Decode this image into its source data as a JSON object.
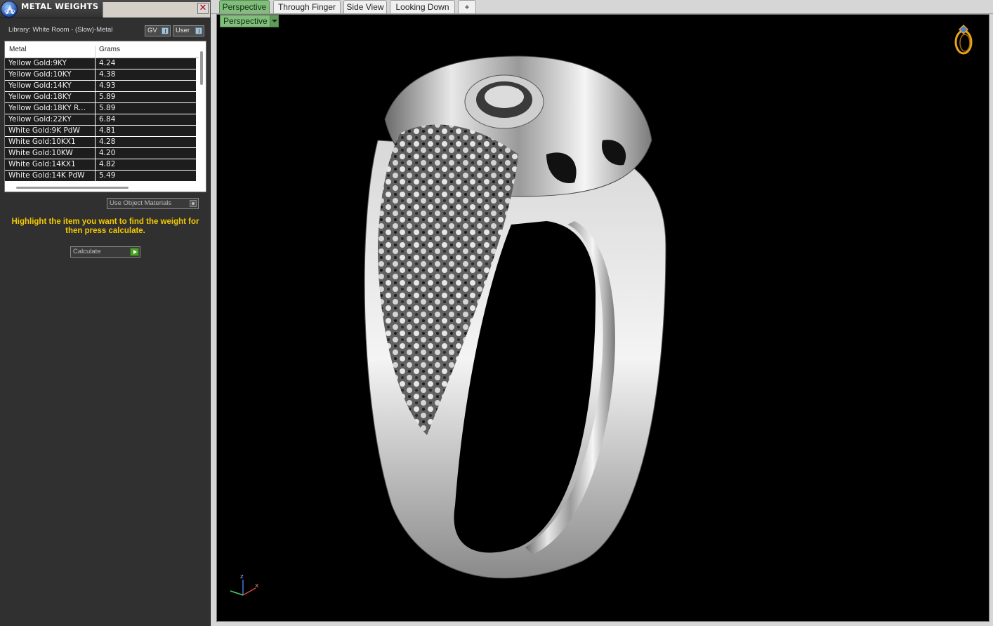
{
  "panel": {
    "title": "METAL WEIGHTS",
    "close_label": "✕",
    "library": "Library: White Room - (Slow)-Metal",
    "toggles": {
      "gv": "GV",
      "user": "User"
    },
    "table": {
      "headers": [
        "Metal",
        "Grams"
      ],
      "rows": [
        {
          "metal": "Yellow Gold:9KY",
          "grams": "4.24"
        },
        {
          "metal": "Yellow Gold:10KY",
          "grams": "4.38"
        },
        {
          "metal": "Yellow Gold:14KY",
          "grams": "4.93"
        },
        {
          "metal": "Yellow Gold:18KY",
          "grams": "5.89"
        },
        {
          "metal": "Yellow Gold:18KY R...",
          "grams": "5.89"
        },
        {
          "metal": "Yellow Gold:22KY",
          "grams": "6.84"
        },
        {
          "metal": "White Gold:9K PdW",
          "grams": "4.81"
        },
        {
          "metal": "White Gold:10KX1",
          "grams": "4.28"
        },
        {
          "metal": "White Gold:10KW",
          "grams": "4.20"
        },
        {
          "metal": "White Gold:14KX1",
          "grams": "4.82"
        },
        {
          "metal": "White Gold:14K PdW",
          "grams": "5.49"
        }
      ]
    },
    "use_object_materials": "Use Object Materials",
    "hint": "Highlight the item you want to find the weight for then press calculate.",
    "calculate": "Calculate"
  },
  "tabs": [
    {
      "label": "Perspective",
      "active": true
    },
    {
      "label": "Through Finger",
      "active": false
    },
    {
      "label": "Side View",
      "active": false
    },
    {
      "label": "Looking Down",
      "active": false
    },
    {
      "label": "+",
      "active": false
    }
  ],
  "viewport": {
    "view_dropdown": "Perspective",
    "axis_labels": {
      "z": "z",
      "x": "x"
    },
    "icons": {
      "app": "app-logo-icon",
      "ring": "ring-thumbnail-icon",
      "axis": "axis-triad-icon"
    }
  }
}
